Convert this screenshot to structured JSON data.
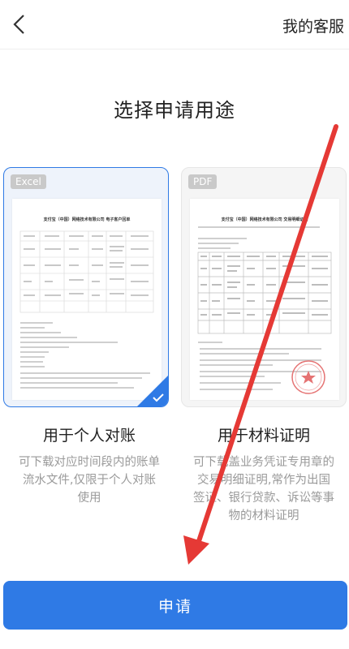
{
  "header": {
    "customer_service": "我的客服"
  },
  "page_title": "选择申请用途",
  "options": [
    {
      "tag": "Excel",
      "doc_title": "支付宝（中国）网络技术有限公司  电子客户回单",
      "label": "用于个人对账",
      "desc_lines": [
        "可下载对应时间段内的账单",
        "流水文件,仅限于个人对账",
        "使用"
      ],
      "selected": true
    },
    {
      "tag": "PDF",
      "doc_title": "支付宝（中国）网络技术有限公司  交易明细证明",
      "label": "用于材料证明",
      "desc_lines": [
        "可下载盖业务凭证专用章的",
        "交易明细证明,常作为出国",
        "签证、银行贷款、诉讼等事",
        "物的材料证明"
      ],
      "selected": false
    }
  ],
  "apply_button": "申请",
  "colors": {
    "accent": "#2f7ae5",
    "annotation": "#e53935"
  },
  "icons": {
    "back": "chevron-left-icon",
    "selected": "check-icon"
  }
}
